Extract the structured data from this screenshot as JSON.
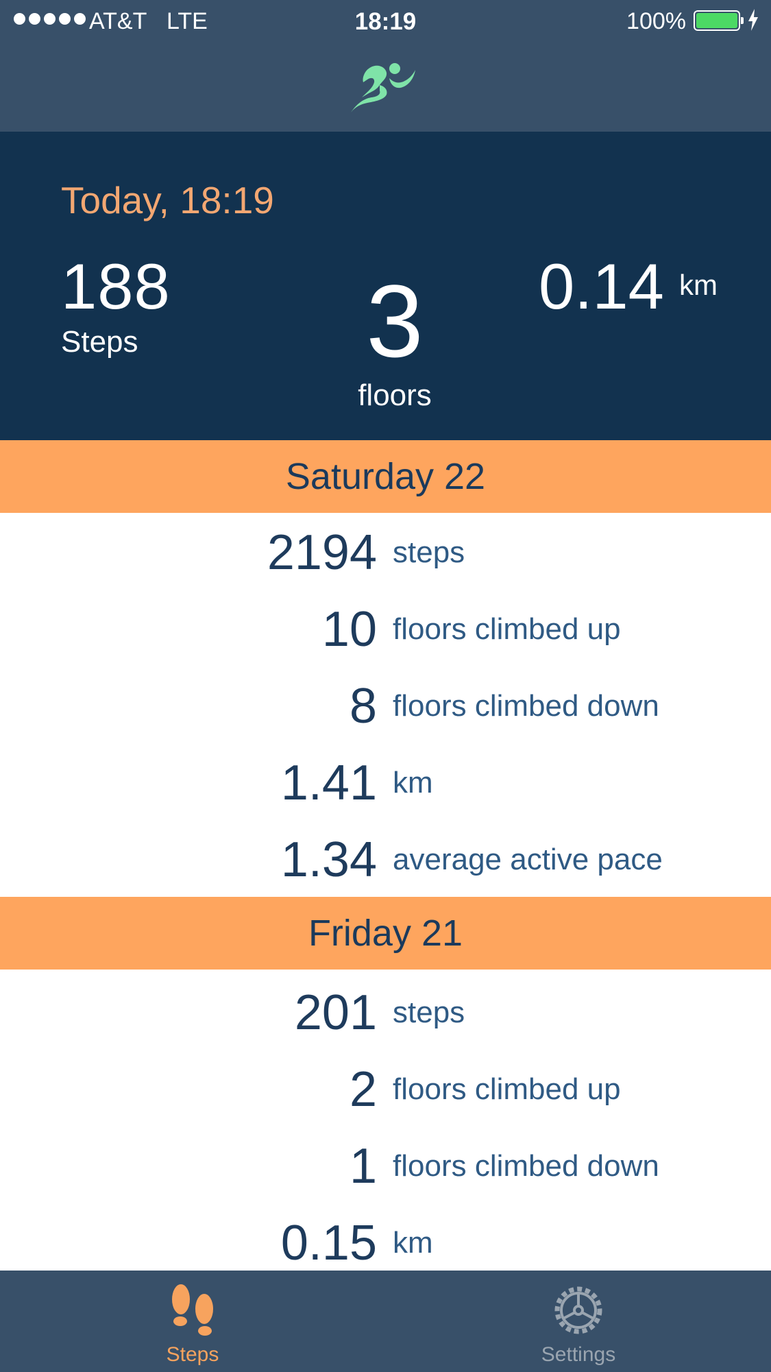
{
  "status_bar": {
    "carrier": "AT&T",
    "network": "LTE",
    "time": "18:19",
    "battery_percent": "100%",
    "battery_level": 1.0,
    "signal_bars": 5
  },
  "nav": {
    "icon": "running-person-icon"
  },
  "today": {
    "title": "Today, 18:19",
    "steps_value": "188",
    "steps_label": "Steps",
    "floors_value": "3",
    "floors_label": "floors",
    "distance_value": "0.14",
    "distance_unit": "km"
  },
  "days": [
    {
      "label": "Saturday 22",
      "rows": [
        {
          "value": "2194",
          "label": "steps"
        },
        {
          "value": "10",
          "label": "floors climbed up"
        },
        {
          "value": "8",
          "label": "floors climbed down"
        },
        {
          "value": "1.41",
          "label": "km"
        },
        {
          "value": "1.34",
          "label": "average active pace"
        }
      ]
    },
    {
      "label": "Friday 21",
      "rows": [
        {
          "value": "201",
          "label": "steps"
        },
        {
          "value": "2",
          "label": "floors climbed up"
        },
        {
          "value": "1",
          "label": "floors climbed down"
        },
        {
          "value": "0.15",
          "label": "km"
        }
      ]
    }
  ],
  "tabs": [
    {
      "label": "Steps",
      "icon": "footprints-icon",
      "active": true
    },
    {
      "label": "Settings",
      "icon": "gear-icon",
      "active": false
    }
  ],
  "colors": {
    "bar": "#385069",
    "hero": "#12324f",
    "accent": "#fea55e",
    "today_text": "#f3a772",
    "icon_green": "#7fe3a8",
    "value_text": "#1e3b5c",
    "label_text": "#2f5a84",
    "tab_active": "#f7a35e",
    "tab_inactive": "#9aa5b0"
  }
}
